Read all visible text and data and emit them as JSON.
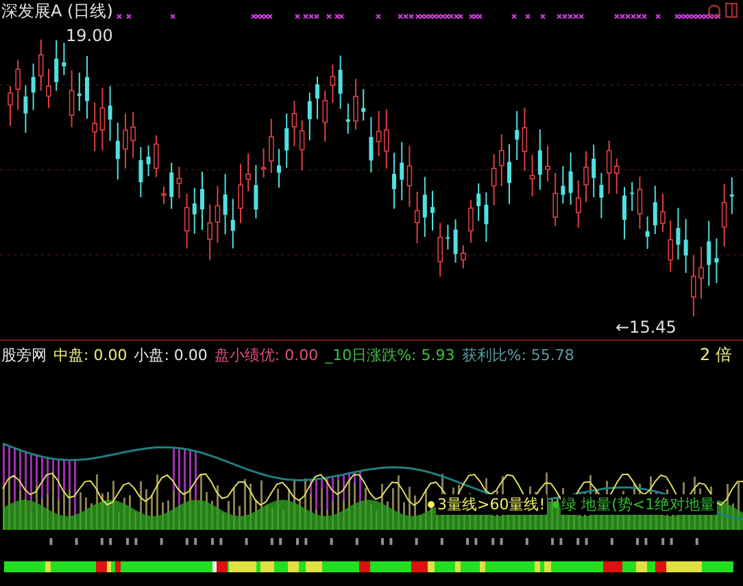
{
  "window": {
    "title": "深发展A (日线)"
  },
  "price_chart": {
    "high_label": "19.00",
    "low_label": "←15.45"
  },
  "indicator": {
    "items": [
      {
        "label": "股旁网",
        "color": "#e8e8e8"
      },
      {
        "label": "中盘: 0.00",
        "color": "#f0f080"
      },
      {
        "label": "小盘: 0.00",
        "color": "#e8e8e8"
      },
      {
        "label": "盘小绩优: 0.00",
        "color": "#e0507a"
      },
      {
        "label": "_10日涨跌%: 5.93",
        "color": "#40c040"
      },
      {
        "label": "获利比%: 55.78",
        "color": "#5a9aa0"
      }
    ],
    "scale": "2 倍"
  },
  "signals": [
    {
      "text": "3量线>60量线!",
      "color": "#f0f060"
    },
    {
      "text": "绿 地量(势<1绝对地量",
      "color": "#30c030"
    }
  ]
}
